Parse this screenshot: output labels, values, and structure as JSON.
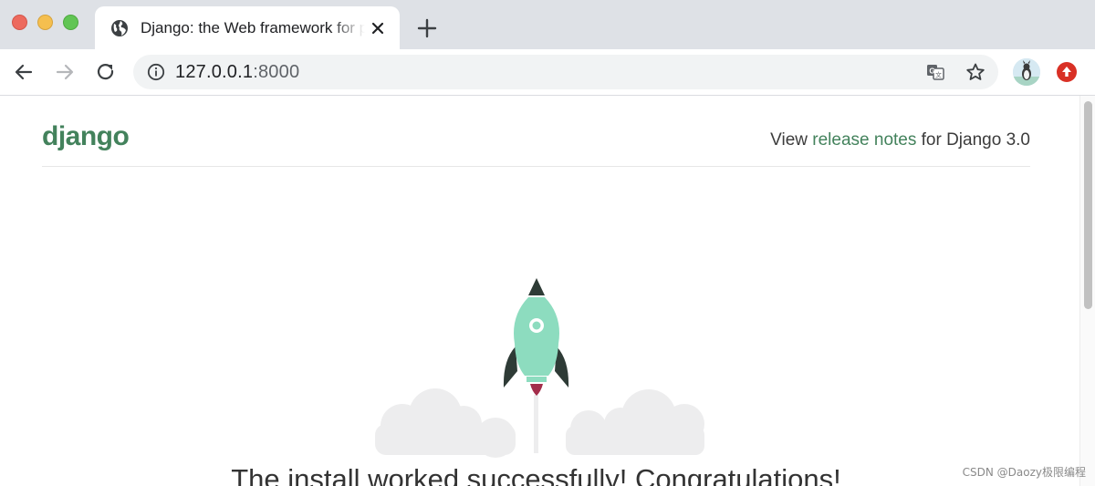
{
  "browser": {
    "tab": {
      "title": "Django: the Web framework for perfectionists with deadlines",
      "favicon": "globe-icon"
    },
    "address_bar": {
      "host": "127.0.0.1",
      "port": ":8000"
    },
    "icons": {
      "back": "back-arrow-icon",
      "forward": "forward-arrow-icon",
      "reload": "reload-icon",
      "info": "info-icon",
      "translate": "translate-icon",
      "bookmark": "star-icon",
      "new_tab": "plus-icon",
      "close_tab": "close-icon",
      "profile": "avatar",
      "extension": "update-arrow-icon"
    }
  },
  "page": {
    "logo": "django",
    "release": {
      "prefix": "View ",
      "link": "release notes",
      "suffix": " for Django 3.0"
    },
    "headline": "The install worked successfully! Congratulations!"
  },
  "watermark": "CSDN @Daozy极限编程",
  "colors": {
    "django_green": "#43825c",
    "rocket_body": "#8ddcbf",
    "rocket_dark": "#2e3b36",
    "flame": "#a32d4a",
    "cloud": "#ededee"
  }
}
